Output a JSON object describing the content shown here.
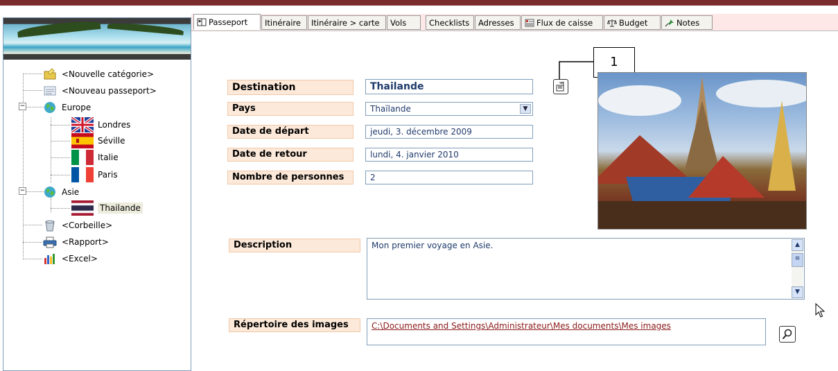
{
  "sidebar": {
    "items": [
      {
        "label": "<Nouvelle catégorie>"
      },
      {
        "label": "<Nouveau passeport>"
      },
      {
        "label": "Europe"
      },
      {
        "label": "Londres"
      },
      {
        "label": "Séville"
      },
      {
        "label": "Italie"
      },
      {
        "label": "Paris"
      },
      {
        "label": "Asie"
      },
      {
        "label": "Thailande"
      },
      {
        "label": "<Corbeille>"
      },
      {
        "label": "<Rapport>"
      },
      {
        "label": "<Excel>"
      }
    ]
  },
  "tabs": [
    {
      "label": "Passeport"
    },
    {
      "label": "Itinéraire"
    },
    {
      "label": "Itinéraire > carte"
    },
    {
      "label": "Vols"
    },
    {
      "label": "Checklists"
    },
    {
      "label": "Adresses"
    },
    {
      "label": "Flux de caisse"
    },
    {
      "label": "Budget"
    },
    {
      "label": "Notes"
    }
  ],
  "form": {
    "destination_label": "Destination",
    "destination_value": "Thailande",
    "pays_label": "Pays",
    "pays_value": "Thaïlande",
    "depart_label": "Date de départ",
    "depart_value": "jeudi, 3. décembre 2009",
    "retour_label": "Date de retour",
    "retour_value": "lundi, 4. janvier 2010",
    "personnes_label": "Nombre de personnes",
    "personnes_value": "2",
    "description_label": "Description",
    "description_value": "Mon premier voyage en Asie.",
    "images_label": "Répertoire des images",
    "images_value": "C:\\Documents and Settings\\Administrateur\\Mes documents\\Mes images"
  },
  "callout": {
    "number": "1"
  }
}
